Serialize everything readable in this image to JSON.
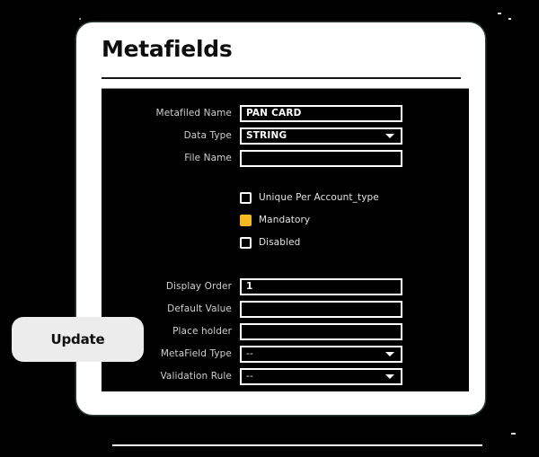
{
  "card": {
    "title": "Metafields"
  },
  "form": {
    "rows": [
      {
        "label": "Metafiled Name",
        "value": "PAN CARD",
        "type": "text"
      },
      {
        "label": "Data Type",
        "value": "STRING",
        "type": "select"
      },
      {
        "label": "File Name",
        "value": "",
        "type": "text"
      }
    ],
    "checkboxes": [
      {
        "label": "Unique Per Account_type",
        "checked": false
      },
      {
        "label": "Mandatory",
        "checked": true
      },
      {
        "label": "Disabled",
        "checked": false
      }
    ],
    "rows2": [
      {
        "label": "Display Order",
        "value": "1",
        "type": "text"
      },
      {
        "label": "Default Value",
        "value": "",
        "type": "text"
      },
      {
        "label": "Place holder",
        "value": "",
        "type": "text"
      },
      {
        "label": "MetaField Type",
        "value": "--",
        "type": "select"
      },
      {
        "label": "Validation Rule",
        "value": "--",
        "type": "select"
      }
    ]
  },
  "actions": {
    "update_label": "Update"
  },
  "colors": {
    "checked_accent": "#f6b91f",
    "panel_bg": "#000000",
    "card_bg": "#ffffff",
    "button_bg": "#ececed"
  }
}
